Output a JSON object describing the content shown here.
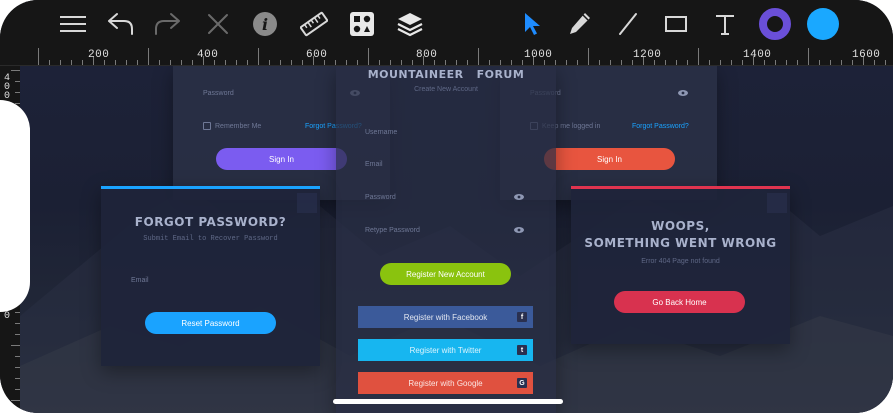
{
  "ruler": {
    "top_labels": [
      "200",
      "400",
      "600",
      "800",
      "1000",
      "1200",
      "1400",
      "1600"
    ],
    "left_labels": [
      "4",
      "0",
      "0",
      "0"
    ]
  },
  "toolbar": {
    "tools": [
      "menu",
      "undo",
      "redo",
      "close",
      "info",
      "ruler",
      "components",
      "layers",
      "pointer",
      "pencil",
      "line",
      "rectangle",
      "text",
      "stroke-color",
      "fill-color"
    ],
    "stroke_color": "#6a4fd8",
    "fill_color": "#1aa8ff",
    "active_tool_color": "#1e8cff"
  },
  "login_card_left": {
    "password_placeholder": "Password",
    "remember_label": "Remember Me",
    "forgot_link": "Forgot Password?",
    "sign_in": "Sign In",
    "button_color": "#7b5cf0"
  },
  "login_card_right": {
    "password_placeholder": "Password",
    "keep_label": "Keep me logged in",
    "forgot_link": "Forgot Password?",
    "sign_in": "Sign In",
    "button_color": "#e8553f"
  },
  "register_card": {
    "brand_left": "MOUNTAINEER",
    "brand_right": "FORUM",
    "subtitle": "Create New Account",
    "username_placeholder": "Username",
    "email_placeholder": "Email",
    "password_placeholder": "Password",
    "retype_placeholder": "Retype Password",
    "register_button": "Register New Account",
    "facebook": "Register with Facebook",
    "twitter": "Register with Twitter",
    "google": "Register with Google",
    "facebook_icon": "f",
    "twitter_icon": "t",
    "google_icon": "G"
  },
  "forgot_card": {
    "title": "FORGOT PASSWORD?",
    "subtitle": "Submit Email to Recover Password",
    "email_placeholder": "Email",
    "reset_button": "Reset Password",
    "accent_color": "#1aa3ff"
  },
  "error_card": {
    "title_line1": "WOOPS,",
    "title_line2": "SOMETHING WENT WRONG",
    "subtitle": "Error 404 Page not found",
    "back_button": "Go Back Home",
    "accent_color": "#e0344f"
  }
}
